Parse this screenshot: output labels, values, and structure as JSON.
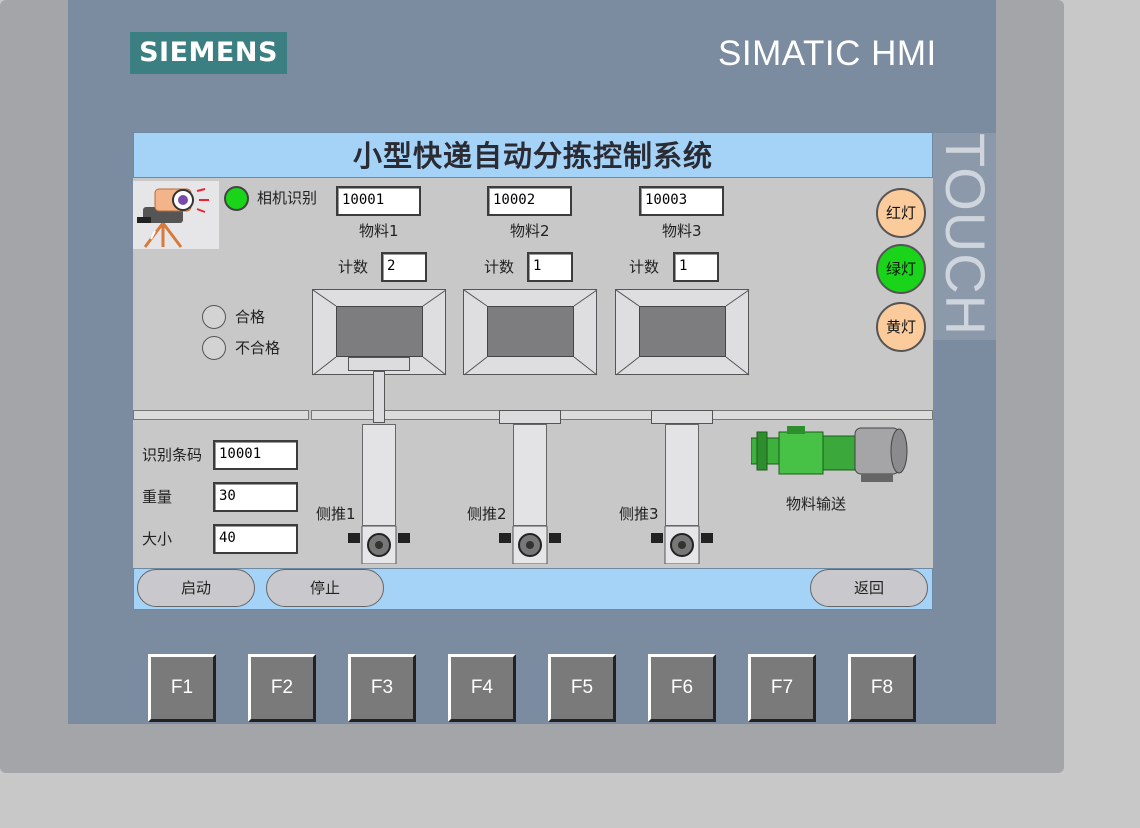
{
  "device": {
    "brand": "SIEMENS",
    "model": "SIMATIC HMI",
    "side_label": "TOUCH"
  },
  "screen": {
    "title": "小型快递自动分拣控制系统",
    "camera": {
      "label": "相机识别",
      "status_color": "#19d419"
    },
    "materials": [
      {
        "code": "10001",
        "label": "物料1",
        "count_label": "计数",
        "count": "2"
      },
      {
        "code": "10002",
        "label": "物料2",
        "count_label": "计数",
        "count": "1"
      },
      {
        "code": "10003",
        "label": "物料3",
        "count_label": "计数",
        "count": "1"
      }
    ],
    "quality": {
      "pass": "合格",
      "fail": "不合格"
    },
    "lights": {
      "red": {
        "label": "红灯",
        "color": "#fccb9c"
      },
      "green": {
        "label": "绿灯",
        "color": "#19d419"
      },
      "yellow": {
        "label": "黄灯",
        "color": "#fccb9c"
      }
    },
    "info": {
      "barcode_label": "识别条码",
      "barcode": "10001",
      "weight_label": "重量",
      "weight": "30",
      "size_label": "大小",
      "size": "40"
    },
    "pushers": [
      "侧推1",
      "侧推2",
      "侧推3"
    ],
    "conveyor_label": "物料输送",
    "buttons": {
      "start": "启动",
      "stop": "停止",
      "back": "返回"
    }
  },
  "function_keys": [
    "F1",
    "F2",
    "F3",
    "F4",
    "F5",
    "F6",
    "F7",
    "F8"
  ]
}
